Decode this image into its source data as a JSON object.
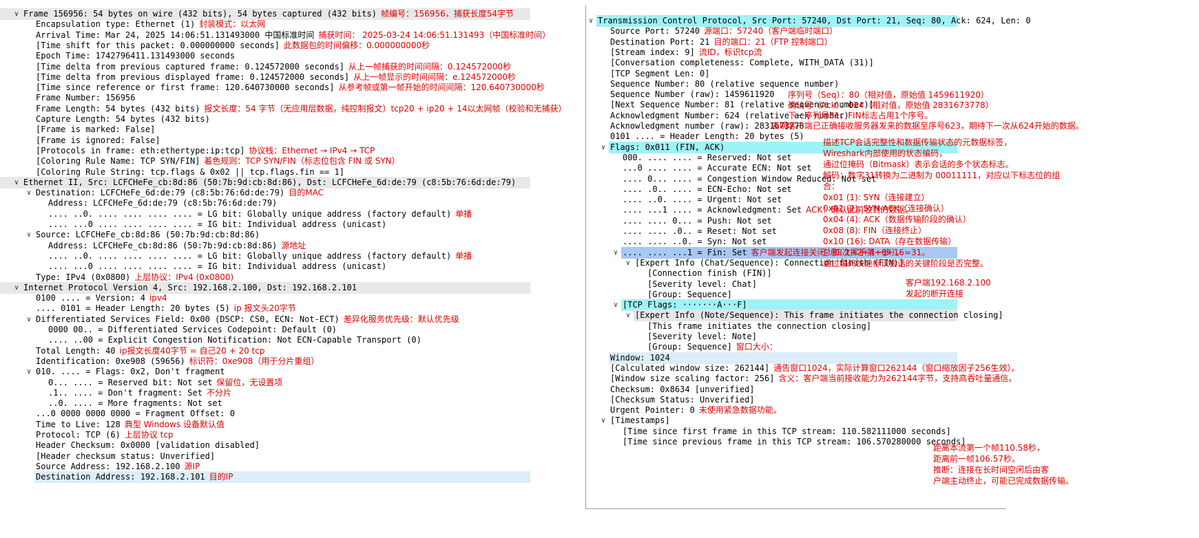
{
  "left": {
    "lines": [
      {
        "d": 0,
        "e": "open",
        "t": "Frame 156956: 54 bytes on wire (432 bits), 54 bytes captured (432 bits)",
        "hl": "header",
        "a": "帧编号：156956，捕获长度54字节"
      },
      {
        "d": 1,
        "e": "none",
        "t": "Encapsulation type: Ethernet (1)",
        "a": "封装模式：以太网"
      },
      {
        "d": 1,
        "e": "none",
        "t": "Arrival Time: Mar 24, 2025 14:06:51.131493000 中国标准时间",
        "a": "捕获时间： 2025-03-24 14:06:51.131493（中国标准时间）"
      },
      {
        "d": 1,
        "e": "none",
        "t": "[Time shift for this packet: 0.000000000 seconds]",
        "a": "此数据包的时间偏移：0.000000000秒"
      },
      {
        "d": 1,
        "e": "none",
        "t": "Epoch Time: 1742796411.131493000 seconds",
        "a": ""
      },
      {
        "d": 1,
        "e": "none",
        "t": "[Time delta from previous captured frame: 0.124572000 seconds]",
        "a": "从上一帧捕获的时间间隔：0.124572000秒"
      },
      {
        "d": 1,
        "e": "none",
        "t": "[Time delta from previous displayed frame: 0.124572000 seconds]",
        "a": "从上一帧显示的时间间隔：e.124572000秒"
      },
      {
        "d": 1,
        "e": "none",
        "t": "[Time since reference or first frame: 120.640730000 seconds]",
        "a": "从参考帧或第一帧开始的时间间隔：120.640730000秒"
      },
      {
        "d": 1,
        "e": "none",
        "t": "Frame Number: 156956",
        "a": ""
      },
      {
        "d": 1,
        "e": "none",
        "t": "Frame Length: 54 bytes (432 bits)",
        "a": "报文长度：54 字节（无应用层数据，纯控制报文）tcp20 + ip20 + 14以太网帧（校验和无捕获）"
      },
      {
        "d": 1,
        "e": "none",
        "t": "Capture Length: 54 bytes (432 bits)",
        "a": ""
      },
      {
        "d": 1,
        "e": "none",
        "t": "[Frame is marked: False]",
        "a": ""
      },
      {
        "d": 1,
        "e": "none",
        "t": "[Frame is ignored: False]",
        "a": ""
      },
      {
        "d": 1,
        "e": "none",
        "t": "[Protocols in frame: eth:ethertype:ip:tcp]",
        "a": "协议栈：Ethernet → IPv4 → TCP"
      },
      {
        "d": 1,
        "e": "none",
        "t": "[Coloring Rule Name: TCP SYN/FIN]",
        "a": "着色规则：TCP SYN/FIN（标志位包含 FIN 或 SYN）"
      },
      {
        "d": 1,
        "e": "none",
        "t": "[Coloring Rule String: tcp.flags & 0x02 || tcp.flags.fin == 1]",
        "a": ""
      },
      {
        "d": 0,
        "e": "open",
        "t": "Ethernet II, Src: LCFCHeFe_cb:8d:86 (50:7b:9d:cb:8d:86), Dst: LCFCHeFe_6d:de:79 (c8:5b:76:6d:de:79)",
        "hl": "header",
        "a": ""
      },
      {
        "d": 1,
        "e": "open",
        "t": "Destination: LCFCHeFe_6d:de:79 (c8:5b:76:6d:de:79)",
        "a": "目的MAC"
      },
      {
        "d": 2,
        "e": "none",
        "t": "Address: LCFCHeFe_6d:de:79 (c8:5b:76:6d:de:79)",
        "a": ""
      },
      {
        "d": 2,
        "e": "none",
        "t": ".... ..0. .... .... .... .... = LG bit: Globally unique address (factory default)",
        "a": "单播"
      },
      {
        "d": 2,
        "e": "none",
        "t": ".... ...0 .... .... .... .... = IG bit: Individual address (unicast)",
        "a": ""
      },
      {
        "d": 1,
        "e": "open",
        "t": "Source: LCFCHeFe_cb:8d:86 (50:7b:9d:cb:8d:86)",
        "a": ""
      },
      {
        "d": 2,
        "e": "none",
        "t": "Address: LCFCHeFe_cb:8d:86 (50:7b:9d:cb:8d:86)",
        "a": "源地址"
      },
      {
        "d": 2,
        "e": "none",
        "t": ".... ..0. .... .... .... .... = LG bit: Globally unique address (factory default)",
        "a": "单播"
      },
      {
        "d": 2,
        "e": "none",
        "t": ".... ...0 .... .... .... .... = IG bit: Individual address (unicast)",
        "a": ""
      },
      {
        "d": 1,
        "e": "none",
        "t": "Type: IPv4 (0x0800)",
        "a": "上层协议：IPv4 (0x0800)"
      },
      {
        "d": 0,
        "e": "open",
        "t": "Internet Protocol Version 4, Src: 192.168.2.100, Dst: 192.168.2.101",
        "hl": "header",
        "a": ""
      },
      {
        "d": 1,
        "e": "none",
        "t": "0100 .... = Version: 4",
        "a": "ipv4"
      },
      {
        "d": 1,
        "e": "none",
        "t": ".... 0101 = Header Length: 20 bytes (5)",
        "a": "ip 报文头20字节"
      },
      {
        "d": 1,
        "e": "open",
        "t": "Differentiated Services Field: 0x00 (DSCP: CS0, ECN: Not-ECT)",
        "a": "差异化服务优先级：默认优先级"
      },
      {
        "d": 2,
        "e": "none",
        "t": "0000 00.. = Differentiated Services Codepoint: Default (0)",
        "a": ""
      },
      {
        "d": 2,
        "e": "none",
        "t": ".... ..00 = Explicit Congestion Notification: Not ECN-Capable Transport (0)",
        "a": ""
      },
      {
        "d": 1,
        "e": "none",
        "t": "Total Length: 40",
        "a": "ip报文长度40字节 = 自己20 + 20 tcp"
      },
      {
        "d": 1,
        "e": "none",
        "t": "Identification: 0xe908 (59656)",
        "a": "标识符：0xe908（用于分片重组）"
      },
      {
        "d": 1,
        "e": "open",
        "t": "010. .... = Flags: 0x2, Don't fragment",
        "a": ""
      },
      {
        "d": 2,
        "e": "none",
        "t": "0... .... = Reserved bit: Not set",
        "a": "保留位，无设置项"
      },
      {
        "d": 2,
        "e": "none",
        "t": ".1.. .... = Don't fragment: Set",
        "a": "不分片"
      },
      {
        "d": 2,
        "e": "none",
        "t": "..0. .... = More fragments: Not set",
        "a": ""
      },
      {
        "d": 1,
        "e": "none",
        "t": "...0 0000 0000 0000 = Fragment Offset: 0",
        "a": ""
      },
      {
        "d": 1,
        "e": "none",
        "t": "Time to Live: 128",
        "a": "典型 Windows 设备默认值"
      },
      {
        "d": 1,
        "e": "none",
        "t": "Protocol: TCP (6)",
        "a": "上层协议 tcp"
      },
      {
        "d": 1,
        "e": "none",
        "t": "Header Checksum: 0x0000 [validation disabled]",
        "a": ""
      },
      {
        "d": 1,
        "e": "none",
        "t": "[Header checksum status: Unverified]",
        "a": ""
      },
      {
        "d": 1,
        "e": "none",
        "t": "Source Address: 192.168.2.100",
        "a": "源IP"
      },
      {
        "d": 1,
        "e": "none",
        "t": "Destination Address: 192.168.2.101",
        "hl": "light",
        "a": "目的IP"
      }
    ]
  },
  "right": {
    "lines": [
      {
        "d": 0,
        "e": "open",
        "t": "Transmission Control Protocol, Src Port: 57240, Dst Port: 21, Seq: 80, Ack: 624, Len: 0",
        "hl": "cyan",
        "a": ""
      },
      {
        "d": 1,
        "e": "none",
        "t": "Source Port: 57240",
        "a": "源端口：57240（客户端临时端口）"
      },
      {
        "d": 1,
        "e": "none",
        "t": "Destination Port: 21",
        "a": "目的端口：21（FTP 控制端口）"
      },
      {
        "d": 1,
        "e": "none",
        "t": "[Stream index: 9]",
        "a": "流ID，标识tcp流"
      },
      {
        "d": 1,
        "e": "none",
        "t": "[Conversation completeness: Complete, WITH_DATA (31)]",
        "a": ""
      },
      {
        "d": 1,
        "e": "none",
        "t": "[TCP Segment Len: 0]",
        "a": ""
      },
      {
        "d": 1,
        "e": "none",
        "t": "Sequence Number: 80    (relative sequence number)",
        "a": ""
      },
      {
        "d": 1,
        "e": "none",
        "t": "Sequence Number (raw): 1459611920",
        "a": ""
      },
      {
        "d": 1,
        "e": "none",
        "t": "[Next Sequence Number: 81    (relative sequence number)]",
        "a": ""
      },
      {
        "d": 1,
        "e": "none",
        "t": "Acknowledgment Number: 624    (relative ack number)",
        "a": ""
      },
      {
        "d": 1,
        "e": "none",
        "t": "Acknowledgment number (raw): 2831673778",
        "a": ""
      },
      {
        "d": 1,
        "e": "none",
        "t": "0101 .... = Header Length: 20 bytes (5)",
        "a": ""
      },
      {
        "d": 1,
        "e": "open",
        "t": "Flags: 0x011 (FIN, ACK)",
        "hl": "cyan",
        "a": ""
      },
      {
        "d": 2,
        "e": "none",
        "t": "000. .... .... = Reserved: Not set",
        "a": ""
      },
      {
        "d": 2,
        "e": "none",
        "t": "...0 .... .... = Accurate ECN: Not set",
        "a": ""
      },
      {
        "d": 2,
        "e": "none",
        "t": ".... 0... .... = Congestion Window Reduced: Not set",
        "a": ""
      },
      {
        "d": 2,
        "e": "none",
        "t": ".... .0.. .... = ECN-Echo: Not set",
        "a": ""
      },
      {
        "d": 2,
        "e": "none",
        "t": ".... ..0. .... = Urgent: Not set",
        "a": ""
      },
      {
        "d": 2,
        "e": "none",
        "t": ".... ...1 .... = Acknowledgment: Set",
        "a": "ACK：确认此前收到的数据。"
      },
      {
        "d": 2,
        "e": "none",
        "t": ".... .... 0... = Push: Not set",
        "a": ""
      },
      {
        "d": 2,
        "e": "none",
        "t": ".... .... .0.. = Reset: Not set",
        "a": ""
      },
      {
        "d": 2,
        "e": "none",
        "t": ".... .... ..0. = Syn: Not set",
        "a": ""
      },
      {
        "d": 2,
        "e": "open",
        "t": ".... .... ...1 = Fin: Set",
        "hl": "blue",
        "a": "客户端发起连接关闭（四次挥手第一步）。"
      },
      {
        "d": 3,
        "e": "open",
        "t": "[Expert Info (Chat/Sequence): Connection finish (FIN)]",
        "a": ""
      },
      {
        "d": 4,
        "e": "none",
        "t": "[Connection finish (FIN)]",
        "a": ""
      },
      {
        "d": 4,
        "e": "none",
        "t": "[Severity level: Chat]",
        "a": ""
      },
      {
        "d": 4,
        "e": "none",
        "t": "[Group: Sequence]",
        "a": ""
      },
      {
        "d": 2,
        "e": "open",
        "t": "[TCP Flags: ·······A···F]",
        "hl": "cyan",
        "a": ""
      },
      {
        "d": 3,
        "e": "open",
        "t": "[Expert Info (Note/Sequence): This frame initiates the connection closing]",
        "hl": "gray",
        "a": ""
      },
      {
        "d": 4,
        "e": "none",
        "t": "[This frame initiates the connection closing]",
        "a": ""
      },
      {
        "d": 4,
        "e": "none",
        "t": "[Severity level: Note]",
        "a": ""
      },
      {
        "d": 4,
        "e": "none",
        "t": "[Group: Sequence]",
        "a": "窗口大小："
      },
      {
        "d": 1,
        "e": "none",
        "t": "Window: 1024",
        "hl": "light",
        "a": ""
      },
      {
        "d": 1,
        "e": "none",
        "t": "[Calculated window size: 262144]",
        "a": "通告窗口1024，实际计算窗口262144（窗口缩放因子256生效）。"
      },
      {
        "d": 1,
        "e": "none",
        "t": "[Window size scaling factor: 256]",
        "a": "含义：客户端当前接收能力为262144字节，支持高吞吐量通信。"
      },
      {
        "d": 1,
        "e": "none",
        "t": "Checksum: 0x8634 [unverified]",
        "a": ""
      },
      {
        "d": 1,
        "e": "none",
        "t": "[Checksum Status: Unverified]",
        "a": ""
      },
      {
        "d": 1,
        "e": "none",
        "t": "Urgent Pointer: 0",
        "a": "未使用紧急数据功能。"
      },
      {
        "d": 1,
        "e": "open",
        "t": "[Timestamps]",
        "a": ""
      },
      {
        "d": 2,
        "e": "none",
        "t": "[Time since first frame in this TCP stream: 110.582111000 seconds]",
        "a": ""
      },
      {
        "d": 2,
        "e": "none",
        "t": "[Time since previous frame in this TCP stream: 106.570280000 seconds]",
        "a": ""
      }
    ],
    "float_notes": [
      "序列号（Seq）：80（相对值，原始值 1459611920）",
      "确认号（Ack）：624（相对值，原始值 2831673778）",
      "下一序列号81，FIN标志占用1个序号。",
      "表明客户端已正确接收服务器发来的数据至序号623，期待下一次从624开始的数据。",
      "描述TCP会话完整性和数据传输状态的元数据标签，",
      "Wireshark内部使用的状态编码，",
      "通过位掩码（Bitmask）表示会话的多个状态标志。",
      "解码：数字31转换为二进制为 00011111，对应以下标志位的组",
      "合：",
      "0x01 (1): SYN（连接建立）",
      "0x02 (2): SYN-ACK（连接确认）",
      "0x04 (4): ACK（数据传输阶段的确认）",
      "0x08 (8): FIN（连接终止）",
      "0x10 (16): DATA（存在数据传输）",
      "总和: 1+2+4+8+16=31。",
      "通过编码快速标识会话的关键阶段是否完整。",
      "客户端192.168.2.100",
      "发起的断开连接",
      "距离本流第一个帧110.58秒，",
      "距离前一帧106.57秒。",
      "推断：连接在长时间空闲后由客",
      "户端主动终止，可能已完成数据传输。"
    ]
  }
}
